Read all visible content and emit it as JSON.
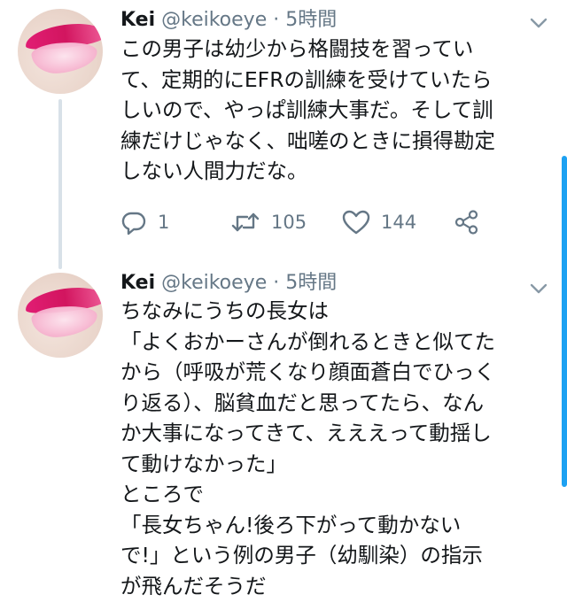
{
  "tweets": [
    {
      "author": {
        "name": "Kei",
        "handle": "@keikoeye"
      },
      "separator": "·",
      "time": "5時間",
      "lines": [
        "この男子は幼少から格闘技を習ってい",
        "て、定期的にEFRの訓練を受けていたら",
        "しいので、やっぱ訓練大事だ。そして訓",
        "練だけじゃなく、咄嗟のときに損得勘定",
        "しない人間力だな。"
      ],
      "actions": {
        "reply_icon": "reply-icon",
        "reply_count": "1",
        "retweet_icon": "retweet-icon",
        "retweet_count": "105",
        "like_icon": "heart-icon",
        "like_count": "144",
        "share_icon": "share-icon"
      }
    },
    {
      "author": {
        "name": "Kei",
        "handle": "@keikoeye"
      },
      "separator": "·",
      "time": "5時間",
      "lines": [
        "ちなみにうちの長女は",
        "「よくおかーさんが倒れるときと似てた",
        "から（呼吸が荒くなり顔面蒼白でひっく",
        "り返る）、脳貧血だと思ってたら、なん",
        "か大事になってきて、えええって動揺し",
        "て動けなかった」",
        "ところで",
        "「長女ちゃん!後ろ下がって動かない",
        "で!」という例の男子（幼馴染）の指示",
        "が飛んだそうだ"
      ]
    }
  ],
  "colors": {
    "text": "#14171a",
    "secondary": "#657786",
    "thread_line": "#d8e1e8",
    "accent": "#1da1f2",
    "lip": "#e11d74"
  },
  "icons": {
    "caret": "chevron-down-icon"
  }
}
